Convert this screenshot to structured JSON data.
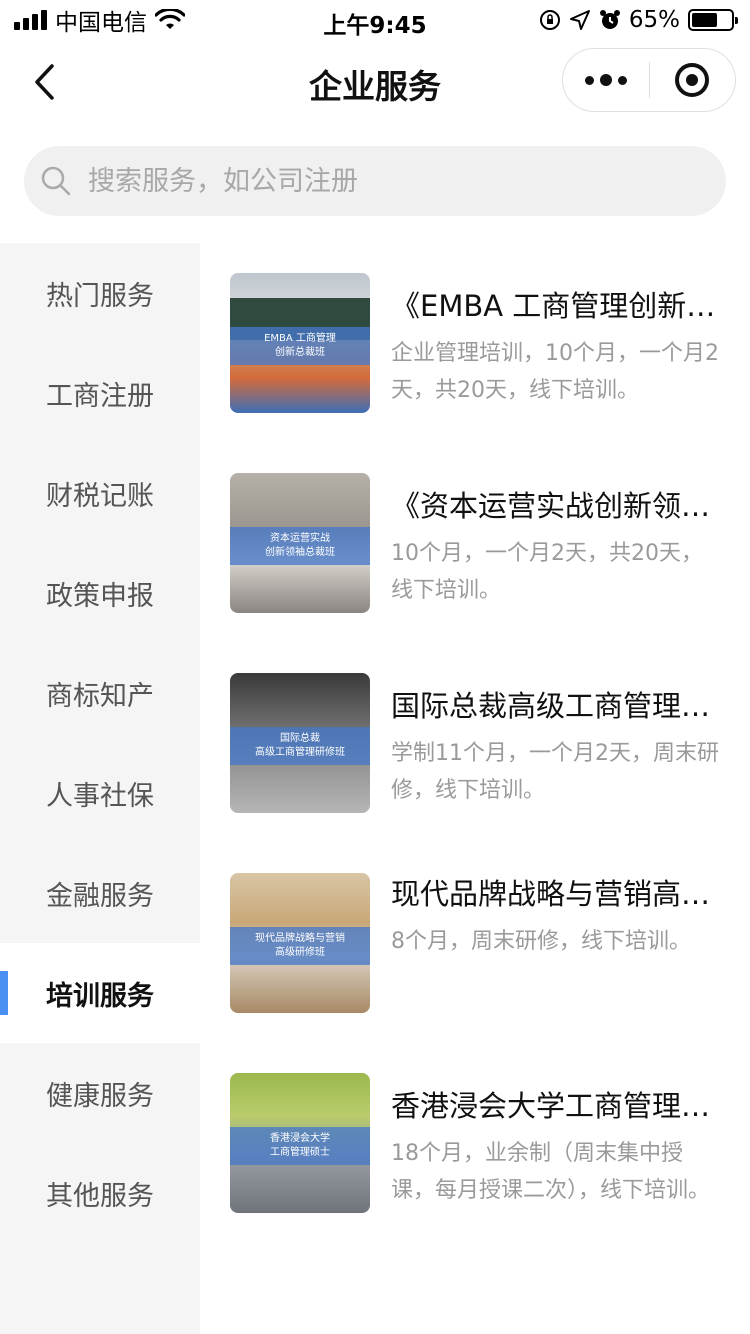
{
  "status_bar": {
    "carrier": "中国电信",
    "time": "上午9:45",
    "battery": "65%",
    "battery_level": 0.65
  },
  "nav": {
    "title": "企业服务"
  },
  "search": {
    "placeholder": "搜索服务，如公司注册"
  },
  "sidebar": {
    "items": [
      {
        "label": "热门服务"
      },
      {
        "label": "工商注册"
      },
      {
        "label": "财税记账"
      },
      {
        "label": "政策申报"
      },
      {
        "label": "商标知产"
      },
      {
        "label": "人事社保"
      },
      {
        "label": "金融服务"
      },
      {
        "label": "培训服务"
      },
      {
        "label": "健康服务"
      },
      {
        "label": "其他服务"
      }
    ],
    "active_index": 7
  },
  "services": [
    {
      "title": "《EMBA 工商管理创新总裁班》",
      "desc": "企业管理培训，10个月，一个月2天，共20天，线下培训。",
      "thumb_line1": "EMBA 工商管理",
      "thumb_line2": "创新总裁班"
    },
    {
      "title": "《资本运营实战创新领袖总裁班》",
      "desc": "10个月，一个月2天，共20天，线下培训。",
      "thumb_line1": "资本运营实战",
      "thumb_line2": "创新领袖总裁班"
    },
    {
      "title": "国际总裁高级工商管理研修班",
      "desc": "学制11个月，一个月2天，周末研修，线下培训。",
      "thumb_line1": "国际总裁",
      "thumb_line2": "高级工商管理研修班"
    },
    {
      "title": "现代品牌战略与营销高级研修班",
      "desc": "8个月，周末研修，线下培训。",
      "thumb_line1": "现代品牌战略与营销",
      "thumb_line2": "高级研修班"
    },
    {
      "title": "香港浸会大学工商管理硕士",
      "desc": "18个月，业余制（周末集中授课，每月授课二次），线下培训。",
      "thumb_line1": "香港浸会大学",
      "thumb_line2": "工商管理硕士"
    }
  ]
}
